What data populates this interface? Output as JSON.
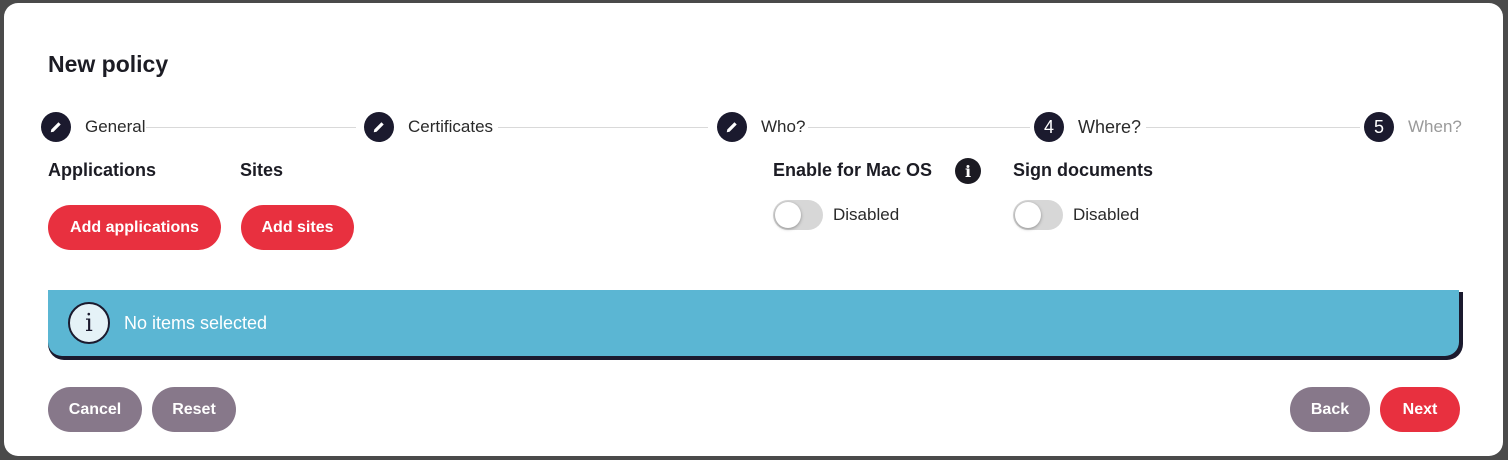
{
  "dialog": {
    "title": "New policy"
  },
  "stepper": {
    "steps": [
      {
        "label": "General",
        "marker": "pencil-icon",
        "state": "completed"
      },
      {
        "label": "Certificates",
        "marker": "pencil-icon",
        "state": "completed"
      },
      {
        "label": "Who?",
        "marker": "pencil-icon",
        "state": "completed"
      },
      {
        "label": "Where?",
        "number": "4",
        "state": "current"
      },
      {
        "label": "When?",
        "number": "5",
        "state": "upcoming"
      }
    ]
  },
  "sections": {
    "applications": {
      "label": "Applications",
      "button": "Add applications"
    },
    "sites": {
      "label": "Sites",
      "button": "Add sites"
    },
    "mac_os": {
      "label": "Enable for Mac OS",
      "info_icon": "i",
      "toggle_state": "Disabled",
      "enabled": false
    },
    "sign_documents": {
      "label": "Sign documents",
      "toggle_state": "Disabled",
      "enabled": false
    }
  },
  "banner": {
    "icon": "i",
    "text": "No items selected"
  },
  "footer": {
    "cancel": "Cancel",
    "reset": "Reset",
    "back": "Back",
    "next": "Next"
  },
  "colors": {
    "primary": "#e8303f",
    "secondary": "#87788a",
    "dark": "#1b1a2e",
    "info_banner": "#5bb6d3"
  }
}
